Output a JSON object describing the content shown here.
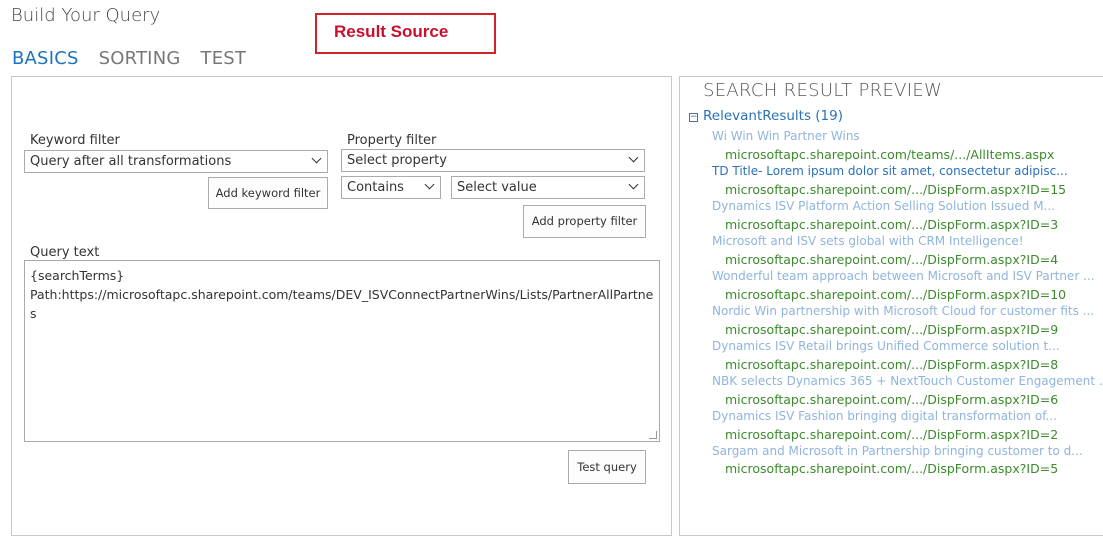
{
  "page": {
    "title": "Build Your Query"
  },
  "annotation": {
    "label": "Result Source"
  },
  "tabs": [
    {
      "label": "BASICS",
      "active": true
    },
    {
      "label": "SORTING",
      "active": false
    },
    {
      "label": "TEST",
      "active": false
    }
  ],
  "keyword_filter": {
    "label": "Keyword filter",
    "selected": "Query after all transformations",
    "add_button": "Add keyword filter"
  },
  "property_filter": {
    "label": "Property filter",
    "property_selected": "Select property",
    "operator_selected": "Contains",
    "value_selected": "Select value",
    "add_button": "Add property filter"
  },
  "query_text": {
    "label": "Query text",
    "line1": "{searchTerms}",
    "line2": "Path:https://microsoftapc.sharepoint.com/teams/DEV_ISVConnectPartnerWins/Lists/PartnerAllPartnerWin",
    "line3": "s"
  },
  "test_button": "Test query",
  "preview": {
    "heading": "SEARCH RESULT PREVIEW",
    "group_toggle": "−",
    "group_label": "RelevantResults (19)",
    "results": [
      {
        "title": "Wi Win Win Partner Wins",
        "url": "microsoftapc.sharepoint.com/teams/.../AllItems.aspx"
      },
      {
        "title": "TD Title- Lorem ipsum dolor sit amet, consectetur adipisc...",
        "url": "microsoftapc.sharepoint.com/.../DispForm.aspx?ID=15"
      },
      {
        "title": "Dynamics ISV Platform Action Selling Solution Issued M...",
        "url": "microsoftapc.sharepoint.com/.../DispForm.aspx?ID=3"
      },
      {
        "title": "Microsoft and ISV sets global with CRM Intelligence!",
        "url": "microsoftapc.sharepoint.com/.../DispForm.aspx?ID=4"
      },
      {
        "title": "Wonderful team approach between Microsoft and ISV Partner ...",
        "url": "microsoftapc.sharepoint.com/.../DispForm.aspx?ID=10"
      },
      {
        "title": "Nordic Win partnership with Microsoft Cloud for customer fits ...",
        "url": "microsoftapc.sharepoint.com/.../DispForm.aspx?ID=9"
      },
      {
        "title": "Dynamics ISV Retail brings Unified Commerce solution t...",
        "url": "microsoftapc.sharepoint.com/.../DispForm.aspx?ID=8"
      },
      {
        "title": "NBK selects Dynamics 365 + NextTouch Customer Engagement ...",
        "url": "microsoftapc.sharepoint.com/.../DispForm.aspx?ID=6"
      },
      {
        "title": "Dynamics ISV Fashion bringing digital transformation of...",
        "url": "microsoftapc.sharepoint.com/.../DispForm.aspx?ID=2"
      },
      {
        "title": "Sargam and Microsoft in Partnership bringing customer to d...",
        "url": "microsoftapc.sharepoint.com/.../DispForm.aspx?ID=5"
      }
    ]
  }
}
